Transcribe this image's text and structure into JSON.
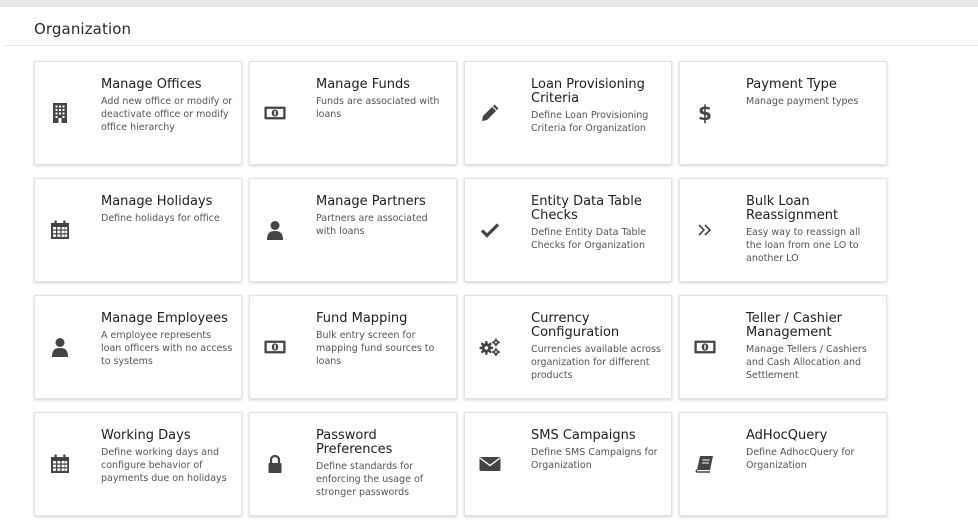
{
  "page": {
    "title": "Organization"
  },
  "cards": [
    {
      "title": "Manage Offices",
      "description": "Add new office or modify or deactivate office or modify office hierarchy",
      "icon": "building-icon"
    },
    {
      "title": "Manage Funds",
      "description": "Funds are associated with loans",
      "icon": "money-icon"
    },
    {
      "title": "Loan Provisioning Criteria",
      "description": "Define Loan Provisioning Criteria for Organization",
      "icon": "pencil-icon"
    },
    {
      "title": "Payment Type",
      "description": "Manage payment types",
      "icon": "dollar-icon"
    },
    {
      "title": "Manage Holidays",
      "description": "Define holidays for office",
      "icon": "calendar-icon"
    },
    {
      "title": "Manage Partners",
      "description": "Partners are associated with loans",
      "icon": "user-icon"
    },
    {
      "title": "Entity Data Table Checks",
      "description": "Define Entity Data Table Checks for Organization",
      "icon": "check-icon"
    },
    {
      "title": "Bulk Loan Reassignment",
      "description": "Easy way to reassign all the loan from one LO to another LO",
      "icon": "double-chevron-right-icon"
    },
    {
      "title": "Manage Employees",
      "description": "A employee represents loan officers with no access to systems",
      "icon": "user-icon"
    },
    {
      "title": "Fund Mapping",
      "description": "Bulk entry screen for mapping fund sources to loans",
      "icon": "money-icon"
    },
    {
      "title": "Currency Configuration",
      "description": "Currencies available across organization for different products",
      "icon": "gears-icon"
    },
    {
      "title": "Teller / Cashier Management",
      "description": "Manage Tellers / Cashiers and Cash Allocation and Settlement",
      "icon": "money-icon"
    },
    {
      "title": "Working Days",
      "description": "Define working days and configure behavior of payments due on holidays",
      "icon": "calendar-icon"
    },
    {
      "title": "Password Preferences",
      "description": "Define standards for enforcing the usage of stronger passwords",
      "icon": "lock-icon"
    },
    {
      "title": "SMS Campaigns",
      "description": "Define SMS Campaigns for Organization",
      "icon": "envelope-icon"
    },
    {
      "title": "AdHocQuery",
      "description": "Define AdhocQuery for Organization",
      "icon": "book-icon"
    }
  ]
}
